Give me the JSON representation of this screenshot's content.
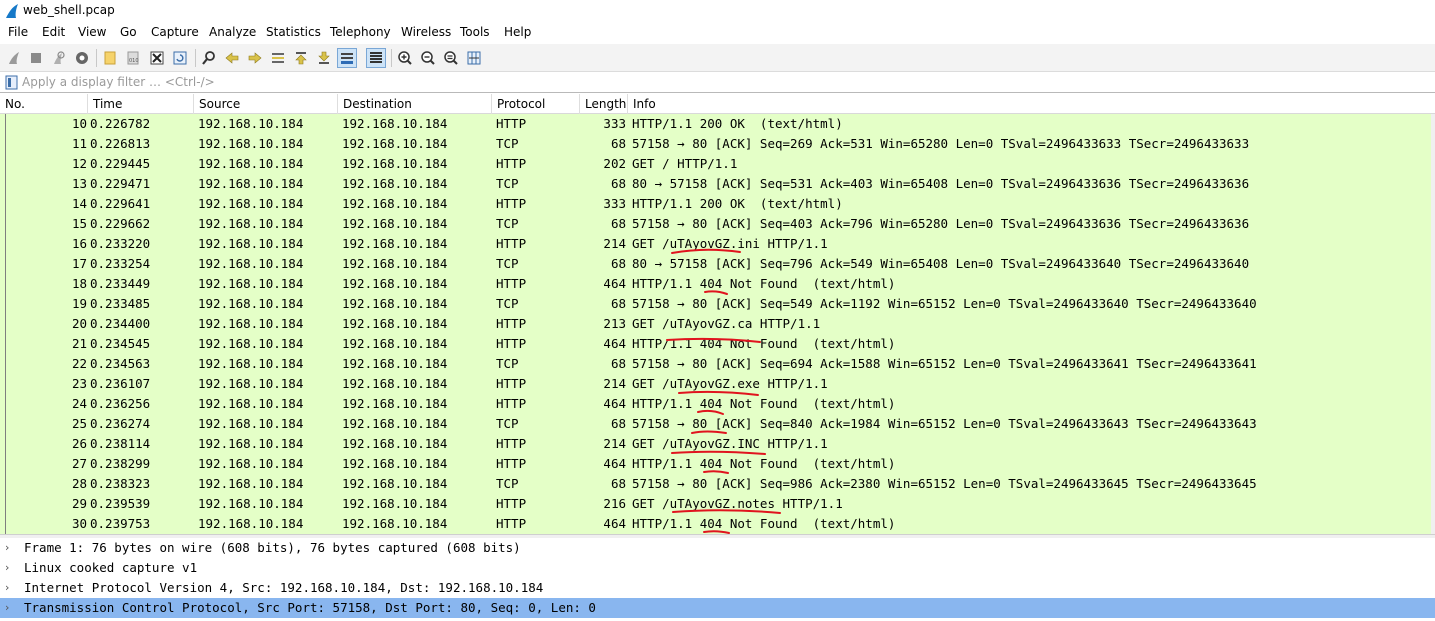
{
  "window": {
    "title": "web_shell.pcap"
  },
  "menu": [
    "File",
    "Edit",
    "View",
    "Go",
    "Capture",
    "Analyze",
    "Statistics",
    "Telephony",
    "Wireless",
    "Tools",
    "Help"
  ],
  "filter": {
    "placeholder": "Apply a display filter … <Ctrl-/>",
    "value": ""
  },
  "columns": {
    "no": "No.",
    "time": "Time",
    "source": "Source",
    "destination": "Destination",
    "protocol": "Protocol",
    "length": "Length",
    "info": "Info"
  },
  "packets": [
    {
      "no": "10",
      "time": "0.226782",
      "src": "192.168.10.184",
      "dst": "192.168.10.184",
      "proto": "HTTP",
      "len": "333",
      "info": "HTTP/1.1 200 OK  (text/html)"
    },
    {
      "no": "11",
      "time": "0.226813",
      "src": "192.168.10.184",
      "dst": "192.168.10.184",
      "proto": "TCP",
      "len": "68",
      "info": "57158 → 80 [ACK] Seq=269 Ack=531 Win=65280 Len=0 TSval=2496433633 TSecr=2496433633"
    },
    {
      "no": "12",
      "time": "0.229445",
      "src": "192.168.10.184",
      "dst": "192.168.10.184",
      "proto": "HTTP",
      "len": "202",
      "info": "GET / HTTP/1.1"
    },
    {
      "no": "13",
      "time": "0.229471",
      "src": "192.168.10.184",
      "dst": "192.168.10.184",
      "proto": "TCP",
      "len": "68",
      "info": "80 → 57158 [ACK] Seq=531 Ack=403 Win=65408 Len=0 TSval=2496433636 TSecr=2496433636"
    },
    {
      "no": "14",
      "time": "0.229641",
      "src": "192.168.10.184",
      "dst": "192.168.10.184",
      "proto": "HTTP",
      "len": "333",
      "info": "HTTP/1.1 200 OK  (text/html)"
    },
    {
      "no": "15",
      "time": "0.229662",
      "src": "192.168.10.184",
      "dst": "192.168.10.184",
      "proto": "TCP",
      "len": "68",
      "info": "57158 → 80 [ACK] Seq=403 Ack=796 Win=65280 Len=0 TSval=2496433636 TSecr=2496433636"
    },
    {
      "no": "16",
      "time": "0.233220",
      "src": "192.168.10.184",
      "dst": "192.168.10.184",
      "proto": "HTTP",
      "len": "214",
      "info": "GET /uTAyovGZ.ini HTTP/1.1"
    },
    {
      "no": "17",
      "time": "0.233254",
      "src": "192.168.10.184",
      "dst": "192.168.10.184",
      "proto": "TCP",
      "len": "68",
      "info": "80 → 57158 [ACK] Seq=796 Ack=549 Win=65408 Len=0 TSval=2496433640 TSecr=2496433640"
    },
    {
      "no": "18",
      "time": "0.233449",
      "src": "192.168.10.184",
      "dst": "192.168.10.184",
      "proto": "HTTP",
      "len": "464",
      "info": "HTTP/1.1 404 Not Found  (text/html)"
    },
    {
      "no": "19",
      "time": "0.233485",
      "src": "192.168.10.184",
      "dst": "192.168.10.184",
      "proto": "TCP",
      "len": "68",
      "info": "57158 → 80 [ACK] Seq=549 Ack=1192 Win=65152 Len=0 TSval=2496433640 TSecr=2496433640"
    },
    {
      "no": "20",
      "time": "0.234400",
      "src": "192.168.10.184",
      "dst": "192.168.10.184",
      "proto": "HTTP",
      "len": "213",
      "info": "GET /uTAyovGZ.ca HTTP/1.1"
    },
    {
      "no": "21",
      "time": "0.234545",
      "src": "192.168.10.184",
      "dst": "192.168.10.184",
      "proto": "HTTP",
      "len": "464",
      "info": "HTTP/1.1 404 Not Found  (text/html)"
    },
    {
      "no": "22",
      "time": "0.234563",
      "src": "192.168.10.184",
      "dst": "192.168.10.184",
      "proto": "TCP",
      "len": "68",
      "info": "57158 → 80 [ACK] Seq=694 Ack=1588 Win=65152 Len=0 TSval=2496433641 TSecr=2496433641"
    },
    {
      "no": "23",
      "time": "0.236107",
      "src": "192.168.10.184",
      "dst": "192.168.10.184",
      "proto": "HTTP",
      "len": "214",
      "info": "GET /uTAyovGZ.exe HTTP/1.1"
    },
    {
      "no": "24",
      "time": "0.236256",
      "src": "192.168.10.184",
      "dst": "192.168.10.184",
      "proto": "HTTP",
      "len": "464",
      "info": "HTTP/1.1 404 Not Found  (text/html)"
    },
    {
      "no": "25",
      "time": "0.236274",
      "src": "192.168.10.184",
      "dst": "192.168.10.184",
      "proto": "TCP",
      "len": "68",
      "info": "57158 → 80 [ACK] Seq=840 Ack=1984 Win=65152 Len=0 TSval=2496433643 TSecr=2496433643"
    },
    {
      "no": "26",
      "time": "0.238114",
      "src": "192.168.10.184",
      "dst": "192.168.10.184",
      "proto": "HTTP",
      "len": "214",
      "info": "GET /uTAyovGZ.INC HTTP/1.1"
    },
    {
      "no": "27",
      "time": "0.238299",
      "src": "192.168.10.184",
      "dst": "192.168.10.184",
      "proto": "HTTP",
      "len": "464",
      "info": "HTTP/1.1 404 Not Found  (text/html)"
    },
    {
      "no": "28",
      "time": "0.238323",
      "src": "192.168.10.184",
      "dst": "192.168.10.184",
      "proto": "TCP",
      "len": "68",
      "info": "57158 → 80 [ACK] Seq=986 Ack=2380 Win=65152 Len=0 TSval=2496433645 TSecr=2496433645"
    },
    {
      "no": "29",
      "time": "0.239539",
      "src": "192.168.10.184",
      "dst": "192.168.10.184",
      "proto": "HTTP",
      "len": "216",
      "info": "GET /uTAyovGZ.notes HTTP/1.1"
    },
    {
      "no": "30",
      "time": "0.239753",
      "src": "192.168.10.184",
      "dst": "192.168.10.184",
      "proto": "HTTP",
      "len": "464",
      "info": "HTTP/1.1 404 Not Found  (text/html)"
    }
  ],
  "details": [
    {
      "text": "Frame 1: 76 bytes on wire (608 bits), 76 bytes captured (608 bits)",
      "selected": false
    },
    {
      "text": "Linux cooked capture v1",
      "selected": false
    },
    {
      "text": "Internet Protocol Version 4, Src: 192.168.10.184, Dst: 192.168.10.184",
      "selected": false
    },
    {
      "text": "Transmission Control Protocol, Src Port: 57158, Dst Port: 80, Seq: 0, Len: 0",
      "selected": true
    }
  ],
  "colors": {
    "http_tcp_row": "#e4ffc7",
    "selected_detail": "#89b6ef",
    "annotation": "#e0141e"
  },
  "toolbar_icons": [
    "start-capture-icon",
    "stop-capture-icon",
    "restart-capture-icon",
    "capture-options-icon",
    "open-file-icon",
    "save-file-icon",
    "close-file-icon",
    "reload-file-icon",
    "find-packet-icon",
    "go-back-icon",
    "go-forward-icon",
    "go-to-packet-icon",
    "go-first-icon",
    "go-last-icon",
    "autoscroll-icon",
    "colorize-icon",
    "zoom-in-icon",
    "zoom-out-icon",
    "normal-size-icon",
    "resize-columns-icon"
  ]
}
